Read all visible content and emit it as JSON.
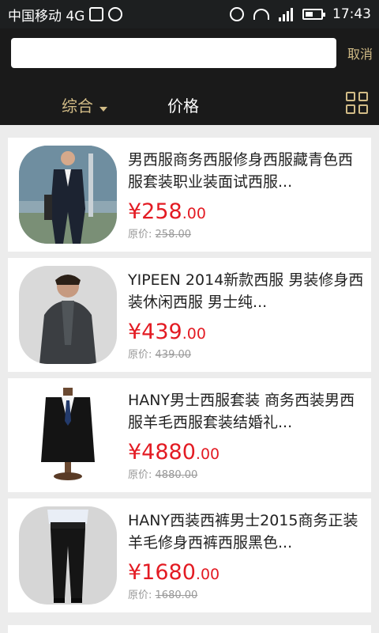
{
  "status_bar": {
    "carrier": "中国移动 4G",
    "time": "17:43",
    "signal_label": "4G"
  },
  "search": {
    "value": "",
    "placeholder": "",
    "cancel_label": "取消"
  },
  "tabs": {
    "combined_label": "综合",
    "price_label": "价格",
    "grid_icon": "grid-icon"
  },
  "products": [
    {
      "title": "男西服商务西服修身西服藏青色西服套装职业装面试西服...",
      "price_int": "¥258",
      "price_dec": ".00",
      "orig_label": "原价:",
      "orig_price": "258.00"
    },
    {
      "title": "YIPEEN 2014新款西服 男装修身西装休闲西服 男士纯...",
      "price_int": "¥439",
      "price_dec": ".00",
      "orig_label": "原价:",
      "orig_price": "439.00"
    },
    {
      "title": "HANY男士西服套装 商务西装男西服羊毛西服套装结婚礼...",
      "price_int": "¥4880",
      "price_dec": ".00",
      "orig_label": "原价:",
      "orig_price": "4880.00"
    },
    {
      "title": "HANY西装西裤男士2015商务正装羊毛修身西裤西服黑色...",
      "price_int": "¥1680",
      "price_dec": ".00",
      "orig_label": "原价:",
      "orig_price": "1680.00"
    }
  ],
  "colors": {
    "accent": "#d1bb86",
    "price": "#e31b23",
    "header_bg": "#1a1a1a"
  }
}
